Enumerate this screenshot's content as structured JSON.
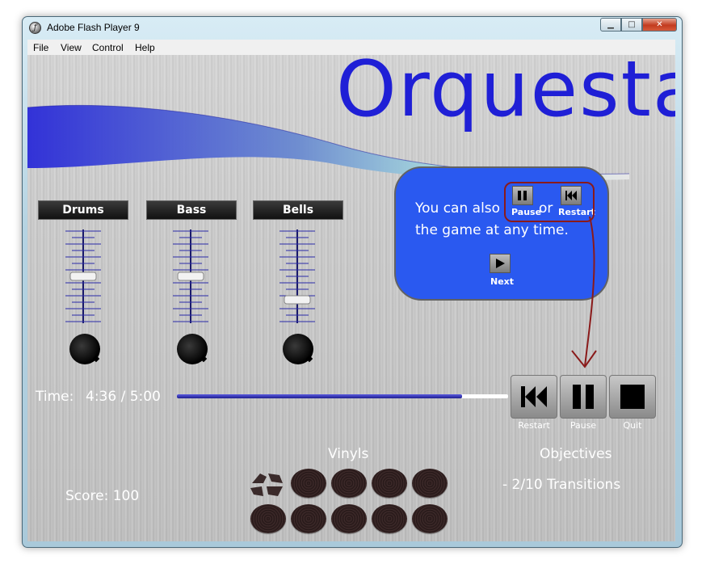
{
  "window": {
    "title": "Adobe Flash Player 9"
  },
  "menu": [
    "File",
    "View",
    "Control",
    "Help"
  ],
  "game": {
    "logo": "Orquesta",
    "channels": [
      {
        "label": "Drums",
        "level": 0.5
      },
      {
        "label": "Bass",
        "level": 0.5
      },
      {
        "label": "Bells",
        "level": 0.25
      }
    ],
    "time_label": "Time:",
    "time_value": "4:36 / 5:00",
    "progress": 0.86,
    "buttons": {
      "restart": "Restart",
      "pause": "Pause",
      "quit": "Quit"
    },
    "vinyls_title": "Vinyls",
    "objectives_title": "Objectives",
    "objective_item": "- 2/10 Transitions",
    "score": "Score: 100",
    "vinyls": {
      "total": 10,
      "broken": 1
    }
  },
  "tip": {
    "line1": "You can also",
    "or": "or",
    "line2": "the game at any time.",
    "pause_label": "Pause",
    "restart_label": "Restart",
    "next_label": "Next"
  },
  "colors": {
    "logo": "#1f1fd6",
    "tip_bg": "#2a59f0",
    "annotation": "#8a1a1a"
  }
}
